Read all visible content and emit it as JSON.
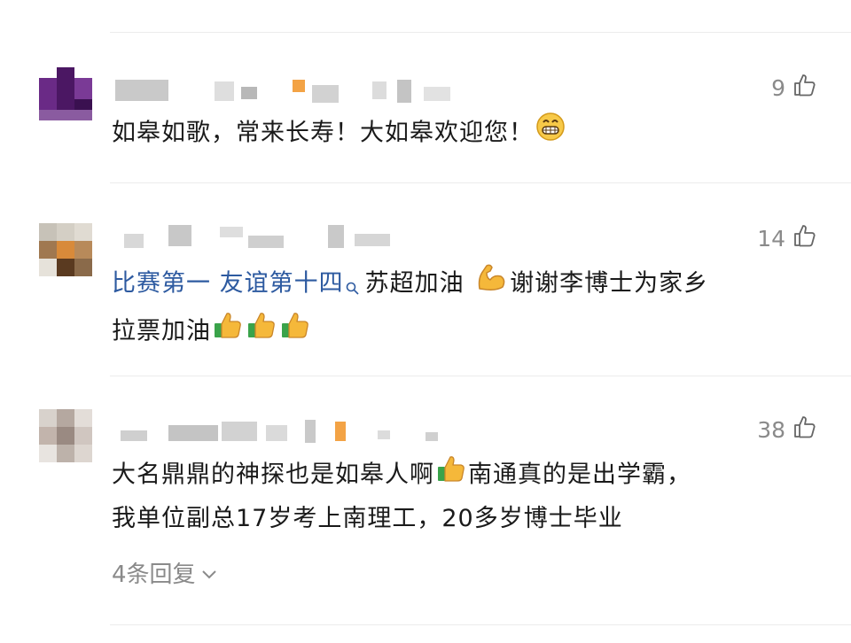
{
  "comments": [
    {
      "likes": "9",
      "text_segments": [
        "如皋如歌，常来长寿！大如皋欢迎您！"
      ],
      "emoji": [
        "grinning-face"
      ]
    },
    {
      "likes": "14",
      "links": [
        "比赛第一 友谊第十四"
      ],
      "text_segments": [
        "苏超加油",
        "谢谢李博士为家乡",
        "拉票加油"
      ],
      "emoji": [
        "flexed-biceps",
        "thumbs-up",
        "thumbs-up",
        "thumbs-up"
      ]
    },
    {
      "likes": "38",
      "text_segments": [
        "大名鼎鼎的神探也是如皋人啊",
        "南通真的是出学霸，",
        "我单位副总17岁考上南理工，20多岁博士毕业"
      ],
      "emoji": [
        "thumbs-up"
      ],
      "replies_label": "4条回复"
    }
  ],
  "colors": {
    "link": "#2d5aa0",
    "meta_gray": "#8a8a8a",
    "divider": "#ececec"
  },
  "icons": [
    "like-icon",
    "search-icon",
    "chevron-down-icon"
  ]
}
